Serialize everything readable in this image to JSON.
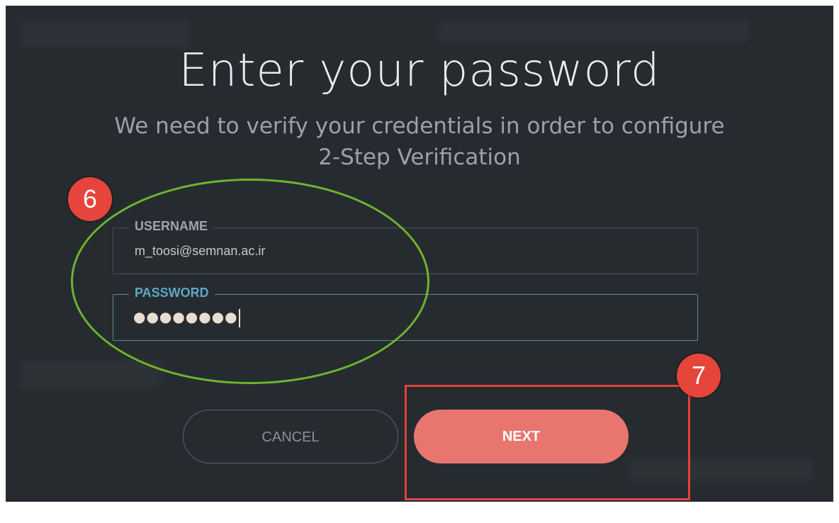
{
  "dialog": {
    "title": "Enter your password",
    "subtitle_line1": "We need to verify your credentials in order to configure",
    "subtitle_line2": "2-Step Verification"
  },
  "username": {
    "label": "USERNAME",
    "value": "m_toosi@semnan.ac.ir"
  },
  "password": {
    "label": "PASSWORD",
    "masked_value": "●●●●●●●●"
  },
  "buttons": {
    "cancel_label": "CANCEL",
    "next_label": "NEXT"
  },
  "annotations": {
    "step6": "6",
    "step7": "7"
  },
  "colors": {
    "background": "#262b30",
    "accent": "#e8766f",
    "annotation_circle": "#6fb52c",
    "annotation_rect": "#e0433b",
    "password_label": "#5fa6c4"
  }
}
